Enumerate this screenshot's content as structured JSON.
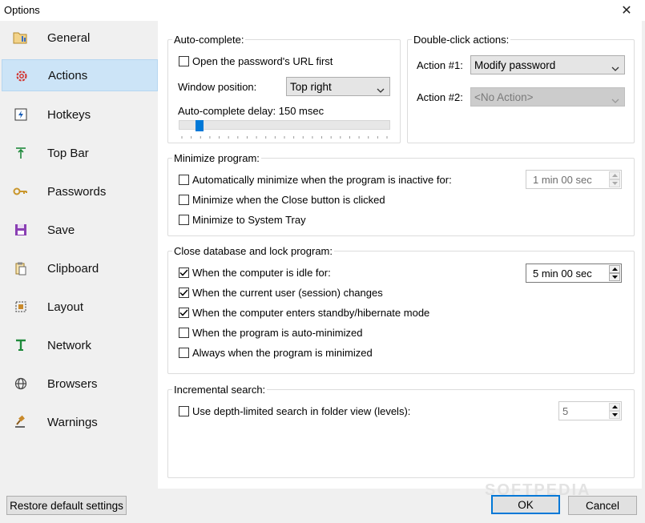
{
  "window": {
    "title": "Options",
    "close_glyph": "✕"
  },
  "sidebar": {
    "items": [
      {
        "label": "General",
        "icon": "general-icon"
      },
      {
        "label": "Actions",
        "icon": "gear-icon",
        "active": true
      },
      {
        "label": "Hotkeys",
        "icon": "hotkey-icon"
      },
      {
        "label": "Top Bar",
        "icon": "topbar-icon"
      },
      {
        "label": "Passwords",
        "icon": "key-icon"
      },
      {
        "label": "Save",
        "icon": "floppy-icon"
      },
      {
        "label": "Clipboard",
        "icon": "clipboard-icon"
      },
      {
        "label": "Layout",
        "icon": "layout-icon"
      },
      {
        "label": "Network",
        "icon": "network-icon"
      },
      {
        "label": "Browsers",
        "icon": "globe-icon"
      },
      {
        "label": "Warnings",
        "icon": "gavel-icon"
      }
    ]
  },
  "autocomplete": {
    "legend": "Auto-complete:",
    "open_url_first": {
      "label": "Open the password's URL first",
      "checked": false
    },
    "window_position_label": "Window position:",
    "window_position_value": "Top right",
    "delay_label": "Auto-complete delay: 150 msec",
    "delay_fraction": 0.15
  },
  "doubleclick": {
    "legend": "Double-click actions:",
    "action1_label": "Action #1:",
    "action1_value": "Modify password",
    "action2_label": "Action #2:",
    "action2_value": "<No Action>"
  },
  "minimize": {
    "legend": "Minimize program:",
    "auto_inactive": {
      "label": "Automatically minimize when the program is inactive for:",
      "checked": false
    },
    "inactive_time": "1 min 00 sec",
    "close_button": {
      "label": "Minimize when the Close button is clicked",
      "checked": false
    },
    "system_tray": {
      "label": "Minimize to System Tray",
      "checked": false
    }
  },
  "lock": {
    "legend": "Close database and lock program:",
    "idle": {
      "label": "When the computer is idle for:",
      "checked": true
    },
    "idle_time": "5 min 00 sec",
    "session": {
      "label": "When the current user (session) changes",
      "checked": true
    },
    "standby": {
      "label": "When the computer enters standby/hibernate mode",
      "checked": true
    },
    "auto_minimized": {
      "label": "When the program is auto-minimized",
      "checked": false
    },
    "always_minimized": {
      "label": "Always when the program is minimized",
      "checked": false
    }
  },
  "search": {
    "legend": "Incremental search:",
    "depth_limited": {
      "label": "Use depth-limited search in folder view (levels):",
      "checked": false
    },
    "levels": "5"
  },
  "footer": {
    "restore_label": "Restore default settings",
    "ok_label": "OK",
    "cancel_label": "Cancel"
  },
  "watermark": "SOFTPEDIA"
}
